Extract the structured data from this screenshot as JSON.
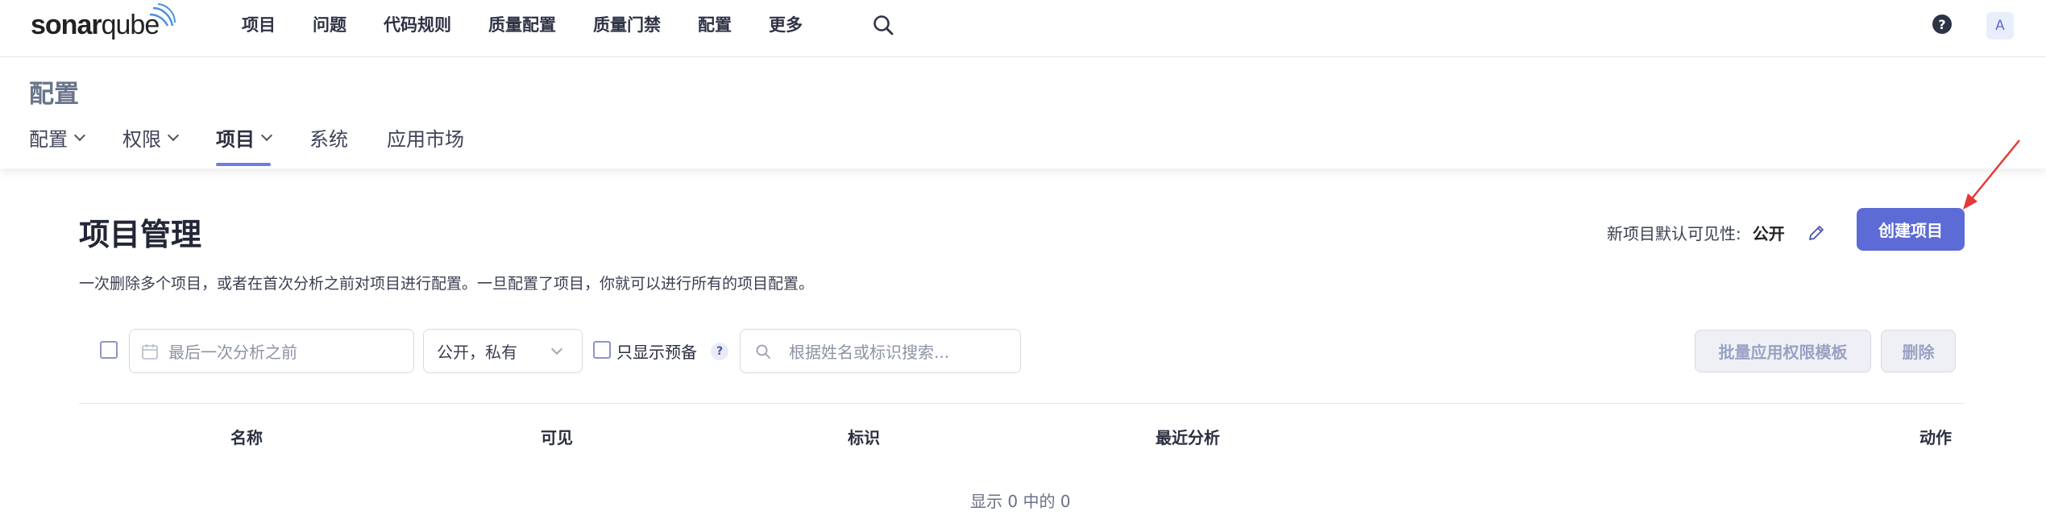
{
  "brand": {
    "logo_bold": "sonar",
    "logo_thin": "qube"
  },
  "nav": {
    "items": [
      "项目",
      "问题",
      "代码规则",
      "质量配置",
      "质量门禁",
      "配置",
      "更多"
    ]
  },
  "user": {
    "avatar_initial": "A",
    "help_symbol": "?"
  },
  "subheader": {
    "section_title": "配置",
    "tabs": [
      {
        "label": "配置",
        "has_dropdown": true,
        "active": false
      },
      {
        "label": "权限",
        "has_dropdown": true,
        "active": false
      },
      {
        "label": "项目",
        "has_dropdown": true,
        "active": true
      },
      {
        "label": "系统",
        "has_dropdown": false,
        "active": false
      },
      {
        "label": "应用市场",
        "has_dropdown": false,
        "active": false
      }
    ]
  },
  "main": {
    "title": "项目管理",
    "description": "一次删除多个项目，或者在首次分析之前对项目进行配置。一旦配置了项目，你就可以进行所有的项目配置。",
    "visibility_label": "新项目默认可见性:",
    "visibility_value": "公开",
    "create_button": "创建项目"
  },
  "filters": {
    "date_placeholder": "最后一次分析之前",
    "visibility_select": "公开，私有",
    "provisioned_only_label": "只显示预备",
    "provisioned_help": "?",
    "search_placeholder": "根据姓名或标识搜索...",
    "bulk_apply_button": "批量应用权限模板",
    "delete_button": "删除"
  },
  "table": {
    "columns": [
      "名称",
      "可见",
      "标识",
      "最近分析",
      "动作"
    ]
  },
  "footer": {
    "count_text": "显示 0 中的 0"
  },
  "colors": {
    "accent": "#5d6bd6",
    "tab_underline": "#6f7de0",
    "annotation_arrow": "#e53935"
  },
  "icons": [
    "search-icon",
    "help-icon",
    "chevron-down-icon",
    "pencil-icon",
    "calendar-icon",
    "search-icon",
    "annotation-arrow"
  ]
}
